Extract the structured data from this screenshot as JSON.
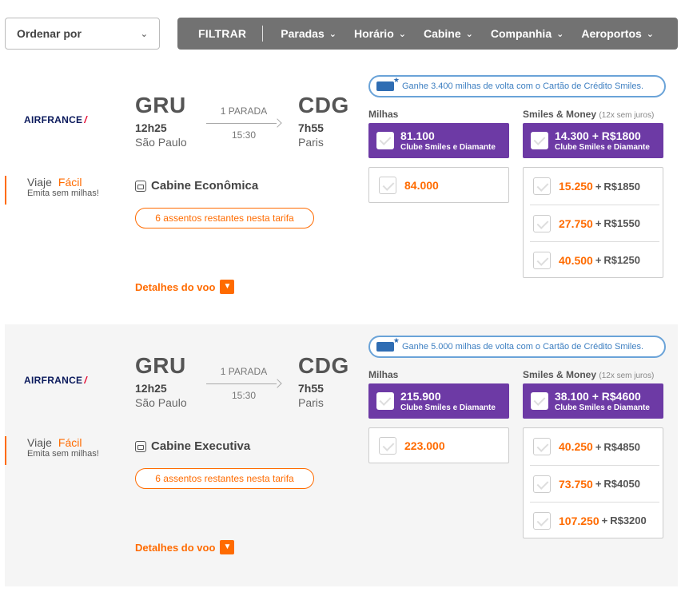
{
  "toolbar": {
    "order_label": "Ordenar por",
    "filter_label": "FILTRAR",
    "filters": [
      "Paradas",
      "Horário",
      "Cabine",
      "Companhia",
      "Aeroportos"
    ]
  },
  "labels": {
    "stops": "1 PARADA",
    "miles_header": "Milhas",
    "money_header": "Smiles & Money",
    "money_note": "(12x sem juros)",
    "club": "Clube Smiles e Diamante",
    "details": "Detalhes do voo",
    "viaje": "Viaje",
    "facil": "Fácil",
    "viaje_sub": "Emita sem milhas!",
    "seats_left": "6 assentos restantes nesta tarifa"
  },
  "flights": [
    {
      "airline": "AIRFRANCE",
      "origin": {
        "code": "GRU",
        "time": "12h25",
        "city": "São Paulo"
      },
      "destination": {
        "code": "CDG",
        "time": "7h55",
        "city": "Paris"
      },
      "duration": "15:30",
      "cabin": "Cabine Econômica",
      "promo": "Ganhe 3.400 milhas de volta com o Cartão de Crédito Smiles.",
      "club_miles": "81.100",
      "club_money": "14.300 + R$1800",
      "miles_option": "84.000",
      "money_options": [
        {
          "miles": "15.250",
          "brl": "R$1850"
        },
        {
          "miles": "27.750",
          "brl": "R$1550"
        },
        {
          "miles": "40.500",
          "brl": "R$1250"
        }
      ]
    },
    {
      "airline": "AIRFRANCE",
      "origin": {
        "code": "GRU",
        "time": "12h25",
        "city": "São Paulo"
      },
      "destination": {
        "code": "CDG",
        "time": "7h55",
        "city": "Paris"
      },
      "duration": "15:30",
      "cabin": "Cabine Executiva",
      "promo": "Ganhe 5.000 milhas de volta com o Cartão de Crédito Smiles.",
      "club_miles": "215.900",
      "club_money": "38.100 + R$4600",
      "miles_option": "223.000",
      "money_options": [
        {
          "miles": "40.250",
          "brl": "R$4850"
        },
        {
          "miles": "73.750",
          "brl": "R$4050"
        },
        {
          "miles": "107.250",
          "brl": "R$3200"
        }
      ]
    }
  ],
  "colors": {
    "accent": "#ff6b00",
    "purple": "#6d3aa5",
    "filter_bar": "#727272",
    "promo": "#3d7fc1"
  }
}
